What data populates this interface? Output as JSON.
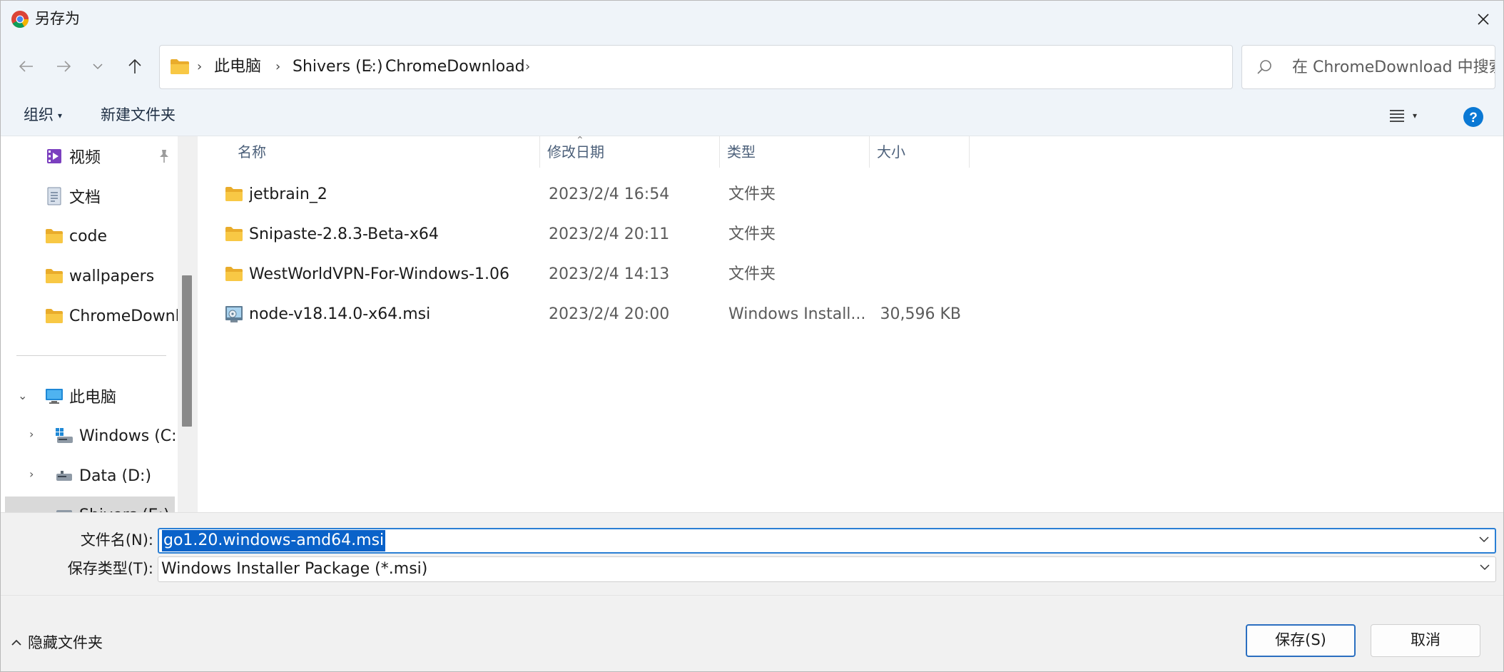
{
  "window": {
    "title": "另存为"
  },
  "nav": {
    "breadcrumb": [
      "此电脑",
      "Shivers (E:)",
      "ChromeDownload"
    ],
    "search_placeholder": "在 ChromeDownload 中搜索"
  },
  "commandbar": {
    "organize": "组织",
    "new_folder": "新建文件夹"
  },
  "sidebar": {
    "quick_access": [
      {
        "label": "视频",
        "icon": "video-icon",
        "pinned": true
      },
      {
        "label": "文档",
        "icon": "document-icon"
      },
      {
        "label": "code",
        "icon": "folder-icon"
      },
      {
        "label": "wallpapers",
        "icon": "folder-icon"
      },
      {
        "label": "ChromeDownload",
        "icon": "folder-icon"
      }
    ],
    "this_pc": {
      "label": "此电脑",
      "icon": "computer-icon"
    },
    "drives": [
      {
        "label": "Windows (C:)",
        "icon": "windows-drive-icon"
      },
      {
        "label": "Data (D:)",
        "icon": "drive-icon"
      },
      {
        "label": "Shivers (E:)",
        "icon": "drive-icon",
        "selected": true
      }
    ]
  },
  "columns": {
    "name": "名称",
    "date": "修改日期",
    "type": "类型",
    "size": "大小"
  },
  "files": [
    {
      "name": "jetbrain_2",
      "date": "2023/2/4 16:54",
      "type": "文件夹",
      "size": "",
      "icon": "folder-icon"
    },
    {
      "name": "Snipaste-2.8.3-Beta-x64",
      "date": "2023/2/4 20:11",
      "type": "文件夹",
      "size": "",
      "icon": "folder-icon"
    },
    {
      "name": "WestWorldVPN-For-Windows-1.06",
      "date": "2023/2/4 14:13",
      "type": "文件夹",
      "size": "",
      "icon": "folder-icon"
    },
    {
      "name": "node-v18.14.0-x64.msi",
      "date": "2023/2/4 20:00",
      "type": "Windows Install...",
      "size": "30,596 KB",
      "icon": "msi-installer-icon"
    }
  ],
  "form": {
    "filename_label": "文件名(N):",
    "filename_value": "go1.20.windows-amd64.msi",
    "filetype_label": "保存类型(T):",
    "filetype_value": "Windows Installer Package (*.msi)"
  },
  "footer": {
    "hide_folders": "隐藏文件夹",
    "save": "保存(S)",
    "cancel": "取消"
  },
  "colors": {
    "accent": "#0a62c9",
    "folder": "#f6c343",
    "chrome_bg": "#eff4f9"
  }
}
